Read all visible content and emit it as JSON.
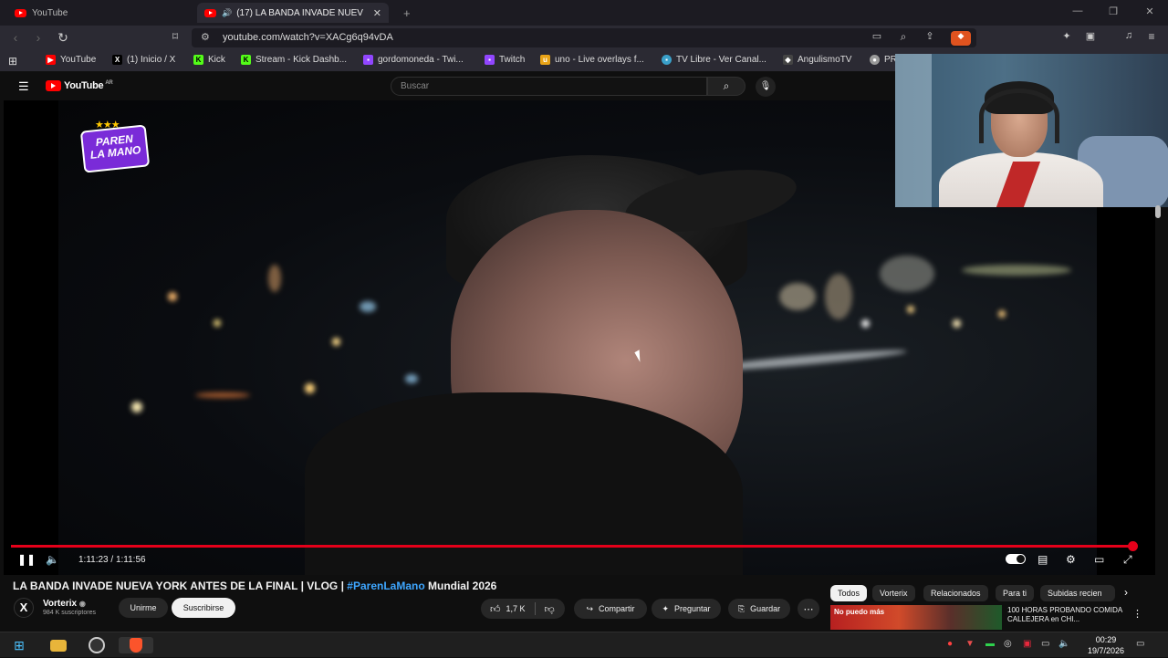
{
  "browser": {
    "tabs": [
      {
        "label": "YouTube"
      },
      {
        "label": "(17) LA BANDA INVADE NUEV"
      }
    ],
    "new_tab_symbol": "+",
    "address": "youtube.com/watch?v=XACg6q94vDA",
    "bookmarks": [
      {
        "label": "YouTube",
        "icon": "youtube-icon"
      },
      {
        "label": "(1) Inicio / X",
        "icon": "x-icon"
      },
      {
        "label": "Kick",
        "icon": "kick-icon"
      },
      {
        "label": "Stream - Kick Dashb...",
        "icon": "kick-icon"
      },
      {
        "label": "gordomoneda - Twi...",
        "icon": "twitch-icon"
      },
      {
        "label": "Twitch",
        "icon": "twitch-icon"
      },
      {
        "label": "uno - Live overlays f...",
        "icon": "uno-icon"
      },
      {
        "label": "TV Libre - Ver Canal...",
        "icon": "tv-icon"
      },
      {
        "label": "AngulismoTV",
        "icon": "angulismo-icon"
      },
      {
        "label": "PR",
        "icon": "chrome-icon"
      }
    ]
  },
  "youtube": {
    "logo_text": "YouTube",
    "region": "AR",
    "search_placeholder": "Buscar"
  },
  "overlay": {
    "logo_line1": "PAREN",
    "logo_line2": "LA MANO",
    "stars": "★★★"
  },
  "player": {
    "time": "1:11:23 / 1:11:56",
    "progress": 0.992
  },
  "video": {
    "title_prefix": "LA BANDA INVADE NUEVA YORK ANTES DE LA FINAL | VLOG | ",
    "title_tag": "#ParenLaMano",
    "title_suffix": " Mundial 2026",
    "channel": "Vorterix",
    "channel_initial": "X",
    "subscribers": "984 K suscriptores",
    "join_label": "Unirme",
    "subscribe_label": "Suscribirse",
    "likes": "1,7 K",
    "share_label": "Compartir",
    "ask_label": "Preguntar",
    "save_label": "Guardar",
    "more_label": "⋯"
  },
  "chips": [
    "Todos",
    "Vorterix",
    "Relacionados",
    "Para ti",
    "Subidas recien"
  ],
  "recommendation": {
    "thumb_text": "No puedo más",
    "title": "100 HORAS PROBANDO COMIDA CALLEJERA en CHI..."
  },
  "taskbar": {
    "time": "00:29",
    "date": "19/7/2026"
  }
}
